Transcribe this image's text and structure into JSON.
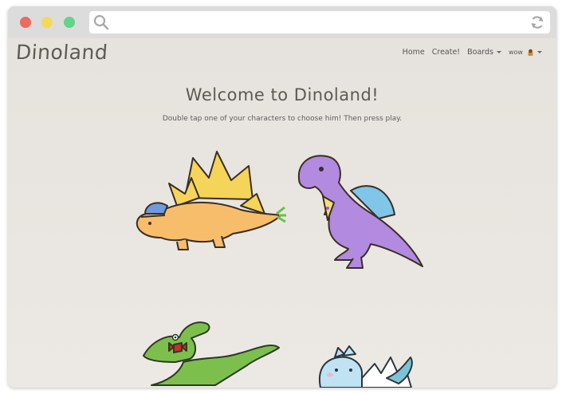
{
  "browser": {
    "icons": {
      "search": "search-icon",
      "reload": "reload-icon"
    },
    "url": ""
  },
  "app": {
    "brand": "Dinoland",
    "nav": {
      "home": "Home",
      "create": "Create!",
      "boards": "Boards",
      "user": "wow"
    },
    "welcome": {
      "title": "Welcome to Dinoland!",
      "subtitle": "Double tap one of your characters to choose him! Then press play."
    },
    "characters": [
      "stegosaurus-character",
      "purple-trex-character",
      "green-pterodactyl-character",
      "blue-baby-dino-character"
    ]
  },
  "colors": {
    "accent": "#5d5a52",
    "background": "#ebe8e2",
    "dot_red": "#ec6a5e",
    "dot_yellow": "#f4d85b",
    "dot_green": "#5fd48a"
  }
}
